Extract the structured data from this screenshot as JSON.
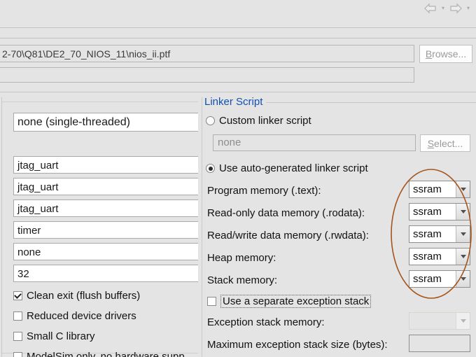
{
  "window": {
    "background_color": "#e4e4e4",
    "accent_color": "#1250b0",
    "annotation_color": "#a3551c"
  },
  "toolbar": {
    "back_icon": "back-arrow-icon",
    "back_dropdown_icon": "chevron-down-icon",
    "forward_icon": "forward-arrow-icon",
    "forward_dropdown_icon": "chevron-down-icon"
  },
  "path_row": {
    "value": "2-70\\Q81\\DE2_70_NIOS_11\\nios_ii.ptf",
    "browse_label": "Browse...",
    "browse_mnemonic": "B",
    "browse_rest": "rowse...",
    "second_field_value": ""
  },
  "left_panel": {
    "fields": [
      {
        "name": "rtos-field",
        "value": "none (single-threaded)"
      },
      {
        "name": "stdout-field",
        "value": "jtag_uart"
      },
      {
        "name": "stderr-field",
        "value": "jtag_uart"
      },
      {
        "name": "stdin-field",
        "value": "jtag_uart"
      },
      {
        "name": "system-timer-field",
        "value": "timer"
      },
      {
        "name": "timestamp-timer-field",
        "value": "none"
      },
      {
        "name": "max-file-descriptors-field",
        "value": "32"
      }
    ],
    "checkboxes": [
      {
        "name": "clean-exit-checkbox",
        "label": "Clean exit (flush buffers)",
        "checked": true
      },
      {
        "name": "reduced-device-drivers-checkbox",
        "label": "Reduced device drivers",
        "checked": false
      },
      {
        "name": "small-c-library-checkbox",
        "label": "Small C library",
        "checked": false
      },
      {
        "name": "modelsim-only-checkbox",
        "label": "ModelSim only, no hardware supp",
        "checked": false
      }
    ]
  },
  "linker_script": {
    "group_title": "Linker Script",
    "custom_radio_label": "Custom linker script",
    "custom_radio_selected": false,
    "custom_script_value": "none",
    "select_label": "Select...",
    "select_mnemonic": "S",
    "select_rest": "elect...",
    "auto_radio_label": "Use auto-generated linker script",
    "auto_radio_selected": true,
    "memory_rows": [
      {
        "name": "program-memory",
        "label": "Program memory (.text):",
        "value": "ssram"
      },
      {
        "name": "readonly-data-memory",
        "label": "Read-only data memory (.rodata):",
        "value": "ssram"
      },
      {
        "name": "readwrite-data-memory",
        "label": "Read/write data memory (.rwdata):",
        "value": "ssram"
      },
      {
        "name": "heap-memory",
        "label": "Heap memory:",
        "value": "ssram"
      },
      {
        "name": "stack-memory",
        "label": "Stack memory:",
        "value": "ssram"
      }
    ],
    "separate_exception_stack_label": "Use a separate exception stack",
    "separate_exception_stack_checked": false,
    "exception_stack_memory_label": "Exception stack memory:",
    "exception_stack_memory_value": "",
    "max_exception_stack_size_label": "Maximum exception stack size (bytes):",
    "max_exception_stack_size_value": ""
  }
}
